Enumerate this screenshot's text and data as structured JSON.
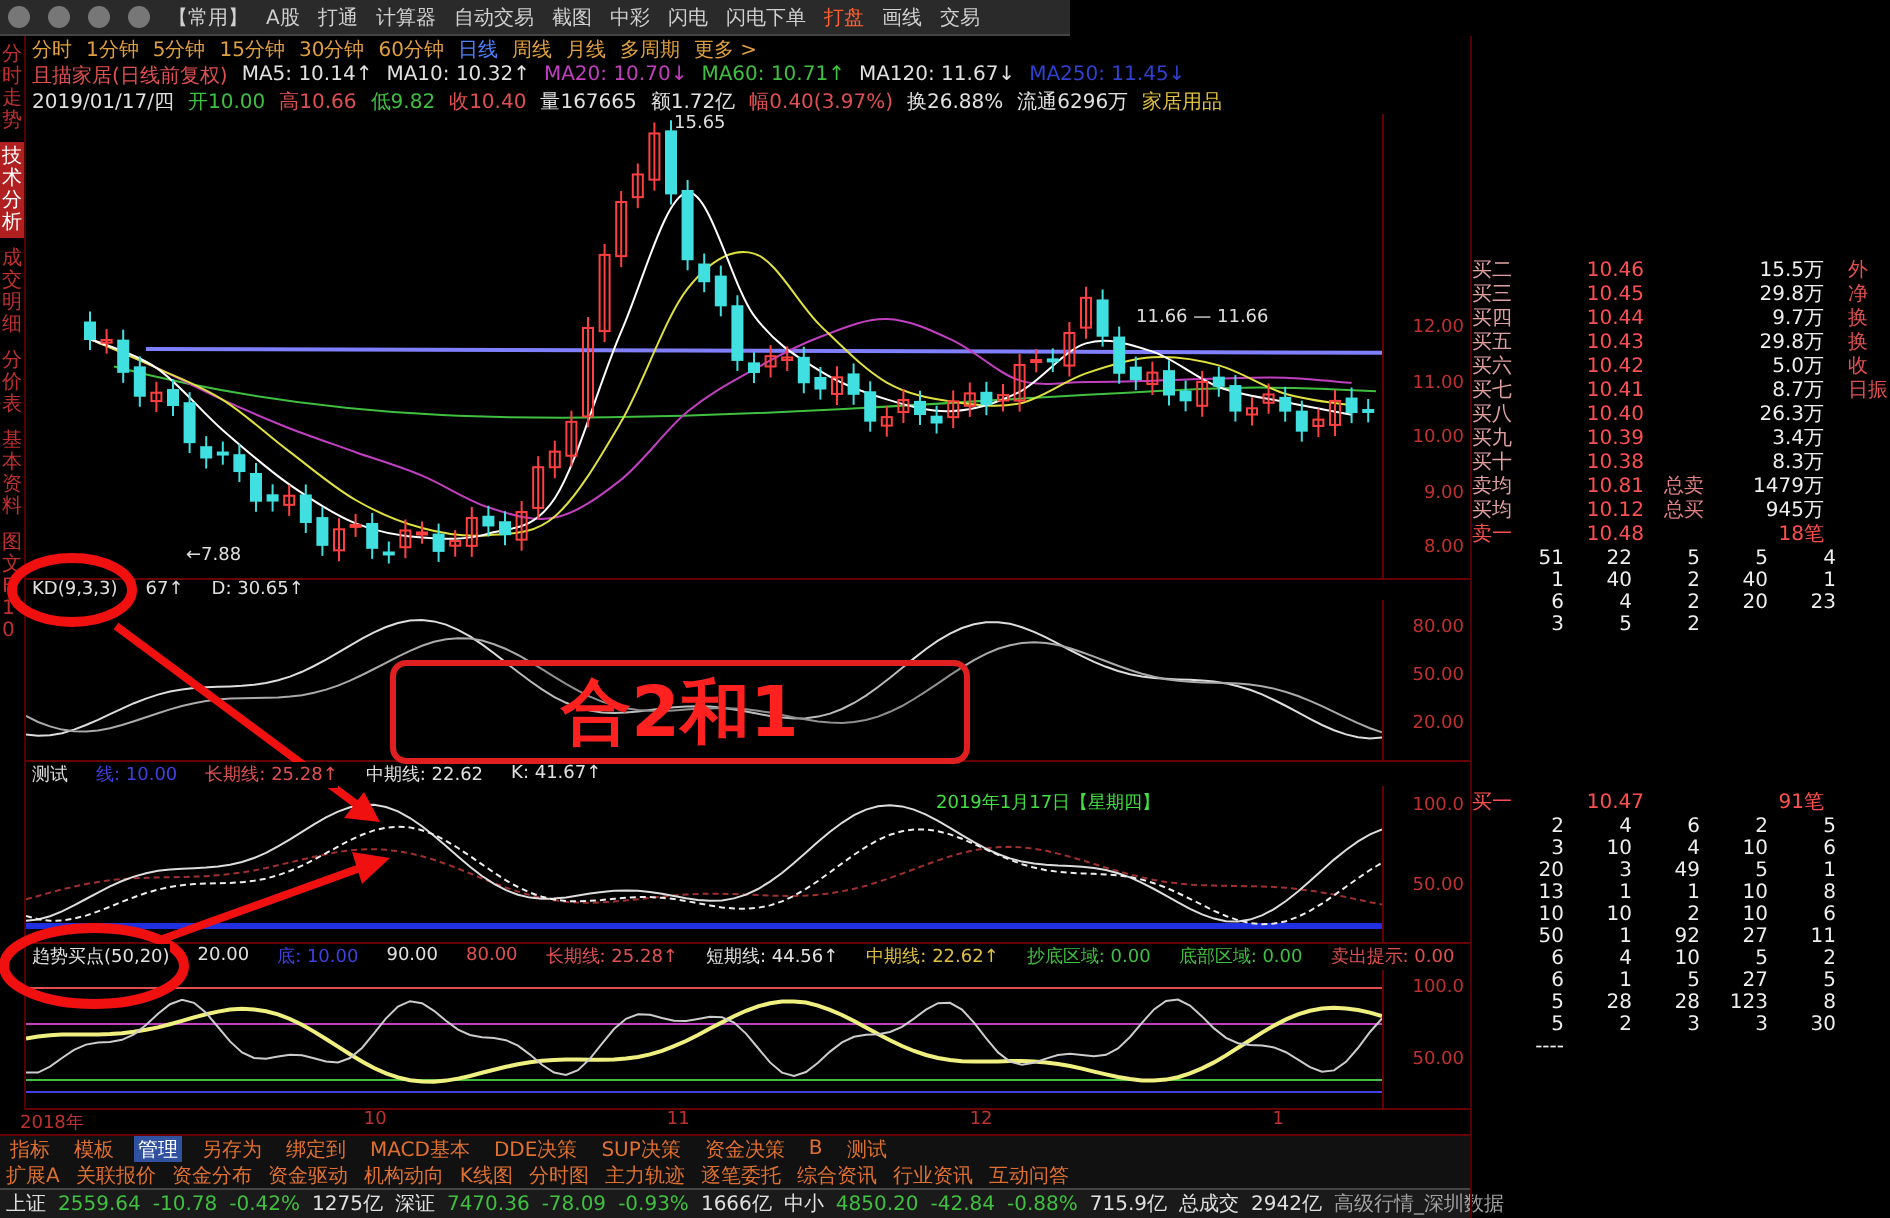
{
  "toolbar": {
    "items": [
      {
        "label": "【常用】",
        "selected": false
      },
      {
        "label": "A股",
        "selected": false
      },
      {
        "label": "打通",
        "selected": false
      },
      {
        "label": "计算器",
        "selected": false
      },
      {
        "label": "自动交易",
        "selected": false
      },
      {
        "label": "截图",
        "selected": false
      },
      {
        "label": "中彩",
        "selected": false
      },
      {
        "label": "闪电",
        "selected": false
      },
      {
        "label": "闪电下单",
        "selected": false
      },
      {
        "label": "打盘",
        "selected": true
      },
      {
        "label": "画线",
        "selected": false
      },
      {
        "label": "交易",
        "selected": false
      }
    ]
  },
  "left_tabs": [
    {
      "label": "分时走势",
      "selected": false
    },
    {
      "label": "技术分析",
      "selected": true
    },
    {
      "label": "成交明细",
      "selected": false
    },
    {
      "label": "分价表",
      "selected": false
    },
    {
      "label": "基本资料",
      "selected": false
    },
    {
      "label": "图文F10",
      "selected": false
    }
  ],
  "period_bar": [
    {
      "label": "分时",
      "selected": false
    },
    {
      "label": "1分钟",
      "selected": false
    },
    {
      "label": "5分钟",
      "selected": false
    },
    {
      "label": "15分钟",
      "selected": false
    },
    {
      "label": "30分钟",
      "selected": false
    },
    {
      "label": "60分钟",
      "selected": false
    },
    {
      "label": "日线",
      "selected": true
    },
    {
      "label": "周线",
      "selected": false
    },
    {
      "label": "月线",
      "selected": false
    },
    {
      "label": "多周期",
      "selected": false
    },
    {
      "label": "更多 >",
      "selected": false
    }
  ],
  "stock_info": {
    "ma_line": [
      {
        "text": "且描家居(日线前复权)",
        "color": "#e05050"
      },
      {
        "text": "MA5: 10.14↑",
        "color": "#e0e0e0"
      },
      {
        "text": "MA10: 10.32↑",
        "color": "#e0e0e0"
      },
      {
        "text": "MA20: 10.70↓",
        "color": "#c040c0"
      },
      {
        "text": "MA60: 10.71↑",
        "color": "#40c040"
      },
      {
        "text": "MA120: 11.67↓",
        "color": "#e0e0e0"
      },
      {
        "text": "MA250: 11.45↓",
        "color": "#3040d0"
      }
    ],
    "quote_line": [
      {
        "text": "2019/01/17/四",
        "color": "#e0e0e0"
      },
      {
        "text": "开10.00",
        "color": "#40c040"
      },
      {
        "text": "高10.66",
        "color": "#e05050"
      },
      {
        "text": "低9.82",
        "color": "#40c040"
      },
      {
        "text": "收10.40",
        "color": "#e05050"
      },
      {
        "text": "量167665",
        "color": "#e0e0e0"
      },
      {
        "text": "额1.72亿",
        "color": "#e0e0e0"
      },
      {
        "text": "幅0.40(3.97%)",
        "color": "#e05050"
      },
      {
        "text": "换26.88%",
        "color": "#e0e0e0"
      },
      {
        "text": "流通6296万",
        "color": "#e0e0e0"
      },
      {
        "text": "家居用品",
        "color": "#e0c040"
      }
    ]
  },
  "price_chart": {
    "y_labels": [
      "12.00",
      "11.00",
      "10.00",
      "9.00",
      "8.00"
    ],
    "high_label": "15.65",
    "low_label": "←7.88",
    "line_label": "11.66 — 11.66"
  },
  "indicators": [
    {
      "kind": "kd",
      "header": [
        {
          "text": "KD(9,3,3)",
          "color": "#e0e0e0"
        },
        {
          "text": "67↑",
          "color": "#e0e0e0"
        },
        {
          "text": "D: 30.65↑",
          "color": "#e0e0e0"
        }
      ],
      "y_labels": [
        "80.00",
        "50.00",
        "20.00"
      ]
    },
    {
      "kind": "test",
      "header": [
        {
          "text": "测试",
          "color": "#e0e0e0"
        },
        {
          "text": "线: 10.00",
          "color": "#4040e0"
        },
        {
          "text": "长期线: 25.28↑",
          "color": "#e05050"
        },
        {
          "text": "中期线: 22.62",
          "color": "#e0e0e0"
        },
        {
          "text": "K: 41.67↑",
          "color": "#e0e0e0"
        }
      ],
      "y_labels": [
        "100.0",
        "50.00"
      ],
      "note": "2019年1月17日【星期四】"
    },
    {
      "kind": "trend",
      "header": [
        {
          "text": "趋势买点(50,20)",
          "color": "#e0e0e0"
        },
        {
          "text": "20.00",
          "color": "#e0e0e0"
        },
        {
          "text": "底: 10.00",
          "color": "#4040e0"
        },
        {
          "text": "90.00",
          "color": "#e0e0e0"
        },
        {
          "text": "80.00",
          "color": "#e05050"
        },
        {
          "text": "长期线: 25.28↑",
          "color": "#e05050"
        },
        {
          "text": "短期线: 44.56↑",
          "color": "#e0e0e0"
        },
        {
          "text": "中期线: 22.62↑",
          "color": "#e0c040"
        },
        {
          "text": "抄底区域: 0.00",
          "color": "#40c040"
        },
        {
          "text": "底部区域: 0.00",
          "color": "#40c040"
        },
        {
          "text": "卖出提示: 0.00",
          "color": "#e05050"
        }
      ],
      "y_labels": [
        "100.0",
        "50.00"
      ]
    }
  ],
  "x_axis": [
    "2018年",
    "10",
    "11",
    "12",
    "1"
  ],
  "indicator_tabs": [
    {
      "label": "指标",
      "selected": false
    },
    {
      "label": "模板",
      "selected": false
    },
    {
      "label": "管理",
      "selected": true
    },
    {
      "label": "另存为",
      "selected": false
    },
    {
      "label": "绑定到",
      "selected": false
    },
    {
      "label": "MACD基本",
      "selected": false
    },
    {
      "label": "DDE决策",
      "selected": false
    },
    {
      "label": "SUP决策",
      "selected": false
    },
    {
      "label": "资金决策",
      "selected": false
    },
    {
      "label": "B",
      "selected": false
    },
    {
      "label": "测试",
      "selected": false
    }
  ],
  "function_tabs": [
    "扩展A",
    "关联报价",
    "资金分布",
    "资金驱动",
    "机构动向",
    "K线图",
    "分时图",
    "主力轨迹",
    "逐笔委托",
    "综合资讯",
    "行业资讯",
    "互动问答"
  ],
  "status_bar": [
    {
      "text": "上证",
      "color": "#e0e0e0"
    },
    {
      "text": "2559.64",
      "color": "#40c040"
    },
    {
      "text": "-10.78",
      "color": "#40c040"
    },
    {
      "text": "-0.42%",
      "color": "#40c040"
    },
    {
      "text": "1275亿",
      "color": "#e0e0e0"
    },
    {
      "text": "深证",
      "color": "#e0e0e0"
    },
    {
      "text": "7470.36",
      "color": "#40c040"
    },
    {
      "text": "-78.09",
      "color": "#40c040"
    },
    {
      "text": "-0.93%",
      "color": "#40c040"
    },
    {
      "text": "1666亿",
      "color": "#e0e0e0"
    },
    {
      "text": "中小",
      "color": "#e0e0e0"
    },
    {
      "text": "4850.20",
      "color": "#40c040"
    },
    {
      "text": "-42.84",
      "color": "#40c040"
    },
    {
      "text": "-0.88%",
      "color": "#40c040"
    },
    {
      "text": "715.9亿",
      "color": "#e0e0e0"
    },
    {
      "text": "总成交",
      "color": "#e0e0e0"
    },
    {
      "text": "2942亿",
      "color": "#e0e0e0"
    },
    {
      "text": "高级行情_深圳数据",
      "color": "#a0a0a0"
    }
  ],
  "order_book": {
    "levels": [
      {
        "label": "买二",
        "price": "10.46",
        "volume": "15.5万"
      },
      {
        "label": "买三",
        "price": "10.45",
        "volume": "29.8万"
      },
      {
        "label": "买四",
        "price": "10.44",
        "volume": "9.7万"
      },
      {
        "label": "买五",
        "price": "10.43",
        "volume": "29.8万"
      },
      {
        "label": "买六",
        "price": "10.42",
        "volume": "5.0万"
      },
      {
        "label": "买七",
        "price": "10.41",
        "volume": "8.7万"
      },
      {
        "label": "买八",
        "price": "10.40",
        "volume": "26.3万"
      },
      {
        "label": "买九",
        "price": "10.39",
        "volume": "3.4万"
      },
      {
        "label": "买十",
        "price": "10.38",
        "volume": "8.3万"
      }
    ],
    "averages": [
      {
        "label": "卖均",
        "price": "10.81",
        "total_label": "总卖",
        "total": "1479万"
      },
      {
        "label": "买均",
        "price": "10.12",
        "total_label": "总买",
        "total": "945万"
      }
    ],
    "sell_one": {
      "label": "卖一",
      "price": "10.48",
      "volume": "18笔"
    },
    "queue": [
      [
        "51",
        "22",
        "5",
        "5",
        "4"
      ],
      [
        "1",
        "40",
        "2",
        "40",
        "1"
      ],
      [
        "6",
        "4",
        "2",
        "20",
        "23"
      ],
      [
        "3",
        "5",
        "2"
      ]
    ],
    "side_labels": [
      "外",
      "净",
      "换",
      "换",
      "收",
      "日振"
    ]
  },
  "buy_one": {
    "label": "买一",
    "price": "10.47",
    "volume": "91笔",
    "queue": [
      [
        "2",
        "4",
        "6",
        "2",
        "5"
      ],
      [
        "3",
        "10",
        "4",
        "10",
        "6"
      ],
      [
        "20",
        "3",
        "49",
        "5",
        "1"
      ],
      [
        "13",
        "1",
        "1",
        "10",
        "8"
      ],
      [
        "10",
        "10",
        "2",
        "10",
        "6"
      ],
      [
        "50",
        "1",
        "92",
        "27",
        "11"
      ],
      [
        "6",
        "4",
        "10",
        "5",
        "2"
      ],
      [
        "6",
        "1",
        "5",
        "27",
        "5"
      ],
      [
        "5",
        "28",
        "28",
        "123",
        "8"
      ],
      [
        "5",
        "2",
        "3",
        "3",
        "30"
      ]
    ],
    "more": "----"
  },
  "annotation": {
    "label": "合2和1"
  }
}
